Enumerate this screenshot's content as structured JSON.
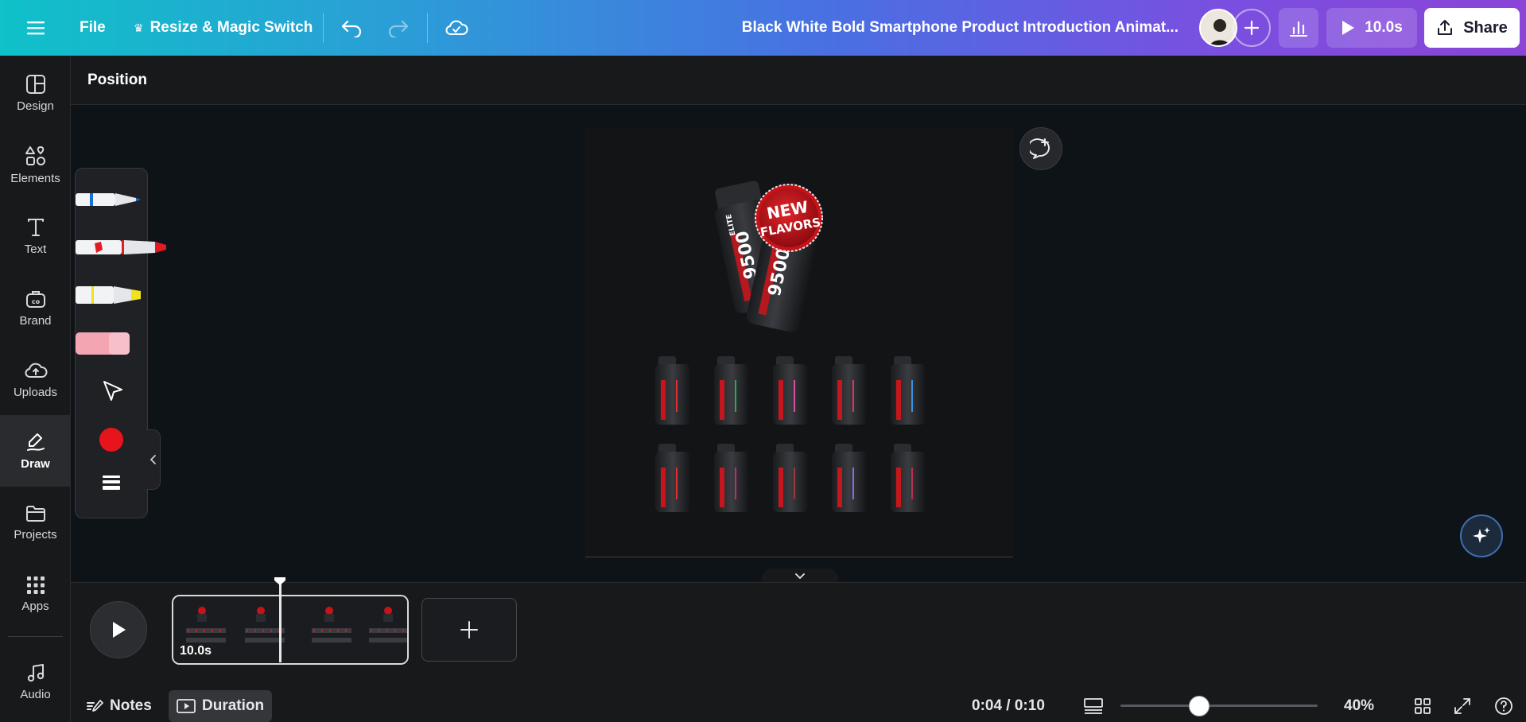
{
  "topbar": {
    "menu_icon": "hamburger-menu-icon",
    "file_label": "File",
    "resize_label": "Resize & Magic Switch",
    "resize_icon": "crown-icon",
    "undo_icon": "undo-icon",
    "redo_icon": "redo-icon",
    "cloud_icon": "cloud-saved-icon",
    "doc_title": "Black White Bold Smartphone Product Introduction Animat...",
    "add_collaborator_icon": "plus-icon",
    "insights_icon": "bar-chart-icon",
    "present_label": "10.0s",
    "share_label": "Share"
  },
  "sidebar": {
    "items": [
      {
        "label": "Design",
        "icon": "design-layout-icon"
      },
      {
        "label": "Elements",
        "icon": "elements-shapes-icon"
      },
      {
        "label": "Text",
        "icon": "text-t-icon"
      },
      {
        "label": "Brand",
        "icon": "brand-briefcase-icon"
      },
      {
        "label": "Uploads",
        "icon": "cloud-upload-icon"
      },
      {
        "label": "Draw",
        "icon": "draw-pen-icon",
        "active": true
      },
      {
        "label": "Projects",
        "icon": "folder-icon"
      },
      {
        "label": "Apps",
        "icon": "apps-grid-icon"
      },
      {
        "label": "Audio",
        "icon": "music-note-icon"
      }
    ]
  },
  "context_bar": {
    "position_label": "Position"
  },
  "canvas": {
    "badge_line1": "NEW",
    "badge_line2": "FLAVORS",
    "product_count_label": "9500",
    "brand_label": "ELITE"
  },
  "draw_panel": {
    "tools": [
      "blue-pen",
      "red-marker",
      "yellow-highlighter",
      "pink-eraser",
      "select-arrow"
    ],
    "selected_color": "#e8141c",
    "colors": {
      "pen": "#1a6fd8",
      "marker": "#e21a24",
      "highlighter": "#f2e11f",
      "eraser": "#f4a5b2"
    }
  },
  "timeline": {
    "clip_duration": "10.0s",
    "add_page_icon": "plus-icon"
  },
  "footer": {
    "notes_label": "Notes",
    "duration_label": "Duration",
    "time_display": "0:04 / 0:10",
    "zoom_label": "40%",
    "zoom_fraction": 0.4
  }
}
